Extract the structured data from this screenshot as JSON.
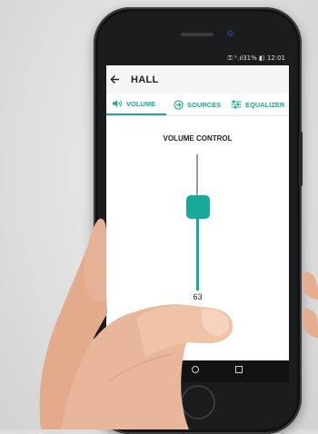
{
  "status_bar": {
    "text": "⚿ ᵇ.ıl31% ▮⟩ 12:01"
  },
  "app_bar": {
    "title": "HALL",
    "back_icon": "arrow-left-icon"
  },
  "tabs": [
    {
      "label": "VOLUME",
      "icon": "speaker-icon",
      "active": true
    },
    {
      "label": "SOURCES",
      "icon": "input-arrow-icon",
      "active": false
    },
    {
      "label": "EQUALIZER",
      "icon": "equalizer-sliders-icon",
      "active": false
    }
  ],
  "volume": {
    "heading": "VOLUME CONTROL",
    "value": "63",
    "level": 0.63
  },
  "colors": {
    "accent": "#17a99a",
    "track_inactive": "#9b9b9b",
    "status_bar_bg": "#1c1c1c"
  }
}
